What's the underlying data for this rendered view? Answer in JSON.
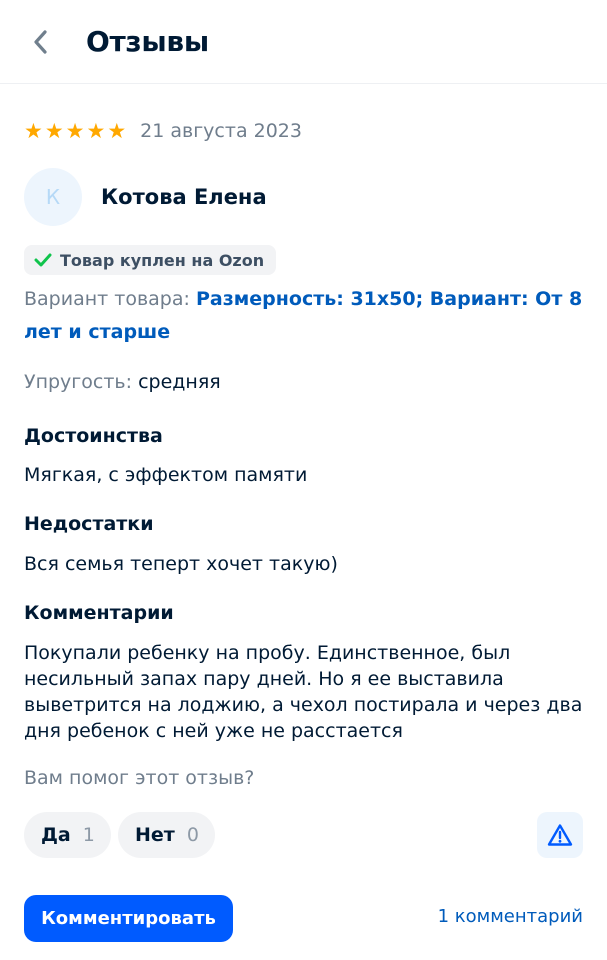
{
  "header": {
    "title": "Отзывы"
  },
  "review": {
    "stars": 5,
    "date": "21 августа 2023",
    "avatar_letter": "К",
    "author": "Котова Елена",
    "badge": "Товар куплен на Ozon",
    "variant_label": "Вариант товара:",
    "variant_value": "Размерность: 31x50; Вариант: От 8 лет и старше",
    "elasticity_label": "Упругость:",
    "elasticity_value": "средняя",
    "pros_title": "Достоинства",
    "pros_text": "Мягкая, с эффектом памяти",
    "cons_title": "Недостатки",
    "cons_text": "Вся семья теперт хочет такую)",
    "comment_title": "Комментарии",
    "comment_text": "Покупали ребенку на пробу. Единственное, был несильный запах пару дней. Но я ее выставила выветрится на лоджию, а чехол постирала и через два дня ребенок с ней уже не расстается"
  },
  "feedback": {
    "question": "Вам помог этот отзыв?",
    "yes_label": "Да",
    "yes_count": "1",
    "no_label": "Нет",
    "no_count": "0"
  },
  "actions": {
    "comment_button": "Комментировать",
    "comments_link": "1 комментарий"
  },
  "colors": {
    "star": "#ffa800",
    "link": "#005bbb",
    "primary_button": "#005bff",
    "check": "#10c44c"
  },
  "icons": {
    "back": "chevron-left-icon",
    "star": "star-icon",
    "check": "check-icon",
    "report": "warning-triangle-icon"
  }
}
